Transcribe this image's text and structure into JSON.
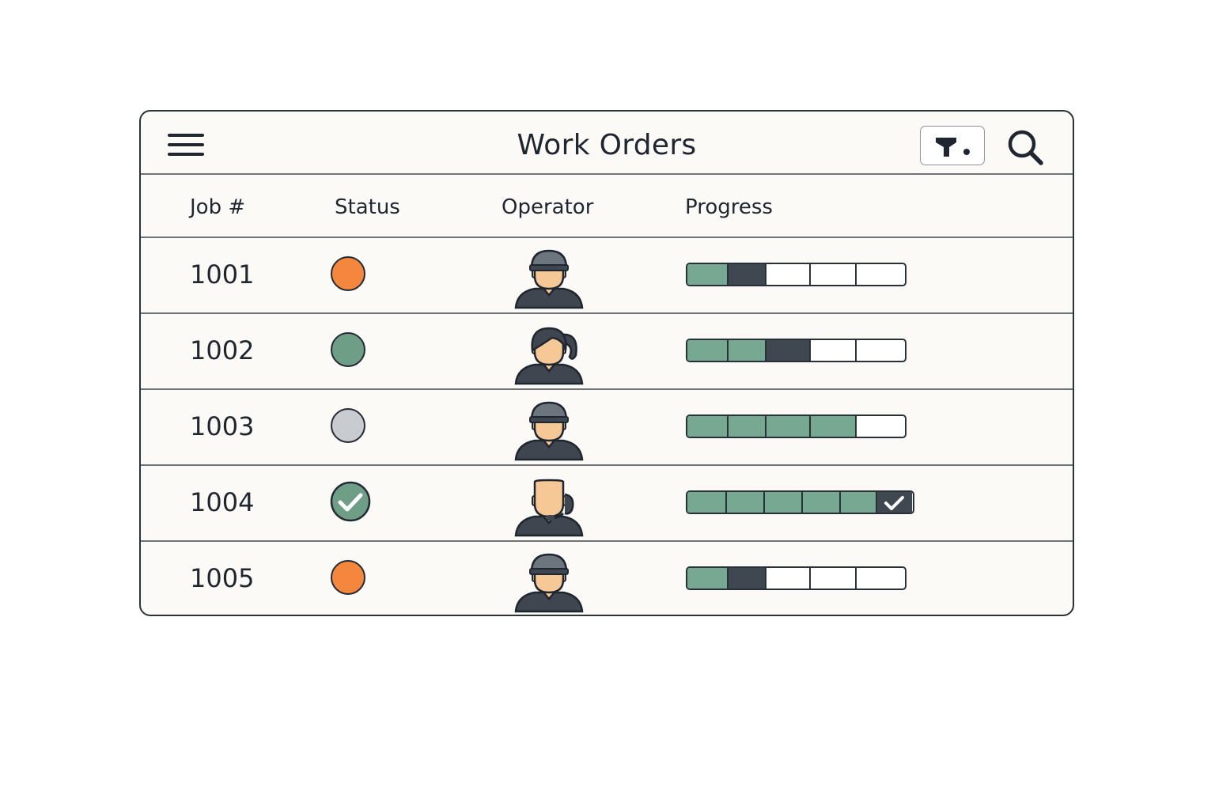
{
  "header": {
    "title": "Work Orders",
    "menu_icon": "hamburger-menu-icon",
    "filter_icon": "filter-icon",
    "search_icon": "search-icon"
  },
  "columns": [
    "Job #",
    "Status",
    "Operator",
    "Progress"
  ],
  "colors": {
    "status_in_progress": "#f4873d",
    "status_active": "#6f9e87",
    "status_idle": "#c8ccd0",
    "status_complete": "#6f9e87",
    "progress_done": "#77a892",
    "progress_current": "#3f4750"
  },
  "rows": [
    {
      "job": "1001",
      "status": "in-progress",
      "operator": "operator-cap",
      "progress": {
        "done": 1,
        "current": 1,
        "total": 5,
        "complete": false
      }
    },
    {
      "job": "1002",
      "status": "active",
      "operator": "operator-ponytail",
      "progress": {
        "done": 2,
        "current": 1,
        "total": 5,
        "complete": false
      }
    },
    {
      "job": "1003",
      "status": "idle",
      "operator": "operator-cap",
      "progress": {
        "done": 4,
        "current": 0,
        "total": 5,
        "complete": false
      }
    },
    {
      "job": "1004",
      "status": "complete",
      "operator": "operator-headset",
      "progress": {
        "done": 5,
        "current": 0,
        "total": 6,
        "complete": true
      }
    },
    {
      "job": "1005",
      "status": "in-progress",
      "operator": "operator-cap",
      "progress": {
        "done": 1,
        "current": 1,
        "total": 5,
        "complete": false
      }
    }
  ]
}
